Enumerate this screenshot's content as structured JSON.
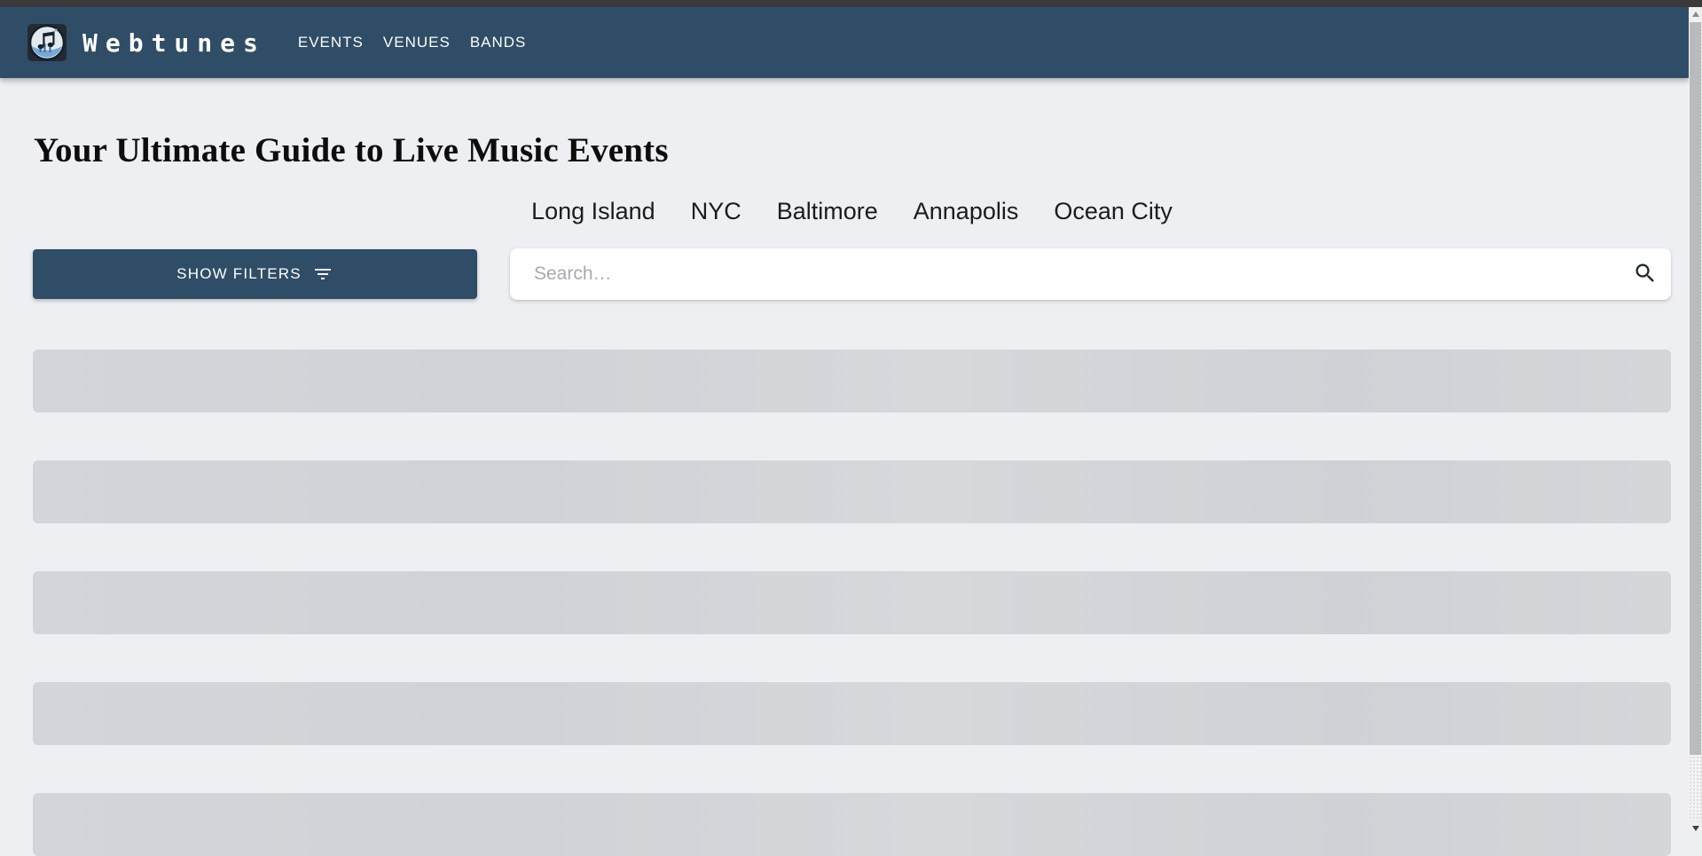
{
  "navbar": {
    "brand": "Webtunes",
    "links": [
      "EVENTS",
      "VENUES",
      "BANDS"
    ]
  },
  "hero": {
    "heading": "Your Ultimate Guide to Live Music Events",
    "city_links": [
      "Long Island",
      "NYC",
      "Baltimore",
      "Annapolis",
      "Ocean City"
    ]
  },
  "controls": {
    "show_filters_label": "SHOW FILTERS",
    "search_placeholder": "Search…",
    "search_value": ""
  },
  "loading": {
    "skeleton_count": 5
  },
  "colors": {
    "top_strip": "#3a3a3a",
    "navbar_bg": "#2f4d66",
    "accent_button": "#2f4d66",
    "page_bg": "#edeff3",
    "skeleton": "#d2d4d9"
  }
}
